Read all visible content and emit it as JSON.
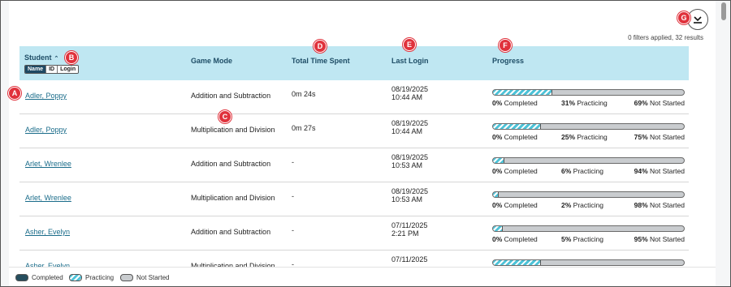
{
  "toolbar": {
    "download_icon": "download-icon",
    "filters_text": "0 filters applied, 32 results"
  },
  "table": {
    "headers": {
      "student": "Student",
      "game_mode": "Game Mode",
      "total_time": "Total Time Spent",
      "last_login": "Last Login",
      "progress": "Progress"
    },
    "sort_icon": "chevron-up-icon",
    "student_toggle": [
      "Name",
      "ID",
      "Login"
    ],
    "student_toggle_selected": "Name",
    "rows": [
      {
        "student": "Adler, Poppy",
        "mode": "Addition and Subtraction",
        "time": "0m 24s",
        "date": "08/19/2025",
        "clock": "10:44 AM",
        "completed": 0,
        "practicing": 31,
        "not_started": 69,
        "completed_label": "0%",
        "practicing_label": "31%",
        "not_started_label": "69%"
      },
      {
        "student": "Adler, Poppy",
        "mode": "Multiplication and Division",
        "time": "0m 27s",
        "date": "08/19/2025",
        "clock": "10:44 AM",
        "completed": 0,
        "practicing": 25,
        "not_started": 75,
        "completed_label": "0%",
        "practicing_label": "25%",
        "not_started_label": "75%"
      },
      {
        "student": "Arlet, Wrenlee",
        "mode": "Addition and Subtraction",
        "time": "-",
        "date": "08/19/2025",
        "clock": "10:53 AM",
        "completed": 0,
        "practicing": 6,
        "not_started": 94,
        "completed_label": "0%",
        "practicing_label": "6%",
        "not_started_label": "94%"
      },
      {
        "student": "Arlet, Wrenlee",
        "mode": "Multiplication and Division",
        "time": "-",
        "date": "08/19/2025",
        "clock": "10:53 AM",
        "completed": 0,
        "practicing": 2,
        "not_started": 98,
        "completed_label": "0%",
        "practicing_label": "2%",
        "not_started_label": "98%"
      },
      {
        "student": "Asher, Evelyn",
        "mode": "Addition and Subtraction",
        "time": "-",
        "date": "07/11/2025",
        "clock": "2:21 PM",
        "completed": 0,
        "practicing": 5,
        "not_started": 95,
        "completed_label": "0%",
        "practicing_label": "5%",
        "not_started_label": "95%"
      },
      {
        "student": "Asher, Evelyn",
        "mode": "Multiplication and Division",
        "time": "-",
        "date": "07/11/2025",
        "clock": "",
        "completed": 0,
        "practicing": 25,
        "not_started": 75,
        "completed_label": "",
        "practicing_label": "",
        "not_started_label": ""
      }
    ],
    "completed_word": "Completed",
    "practicing_word": "Practicing",
    "not_started_word": "Not Started"
  },
  "legend": {
    "completed": "Completed",
    "practicing": "Practicing",
    "not_started": "Not Started"
  },
  "markers": [
    "A",
    "B",
    "C",
    "D",
    "E",
    "F",
    "G"
  ],
  "colors": {
    "header_bg": "#bfe7f2",
    "link": "#1a6c8a",
    "practicing": "#4ec3d8",
    "completed": "#264e5e",
    "not_started": "#c9cccf",
    "marker": "#e0323c"
  }
}
